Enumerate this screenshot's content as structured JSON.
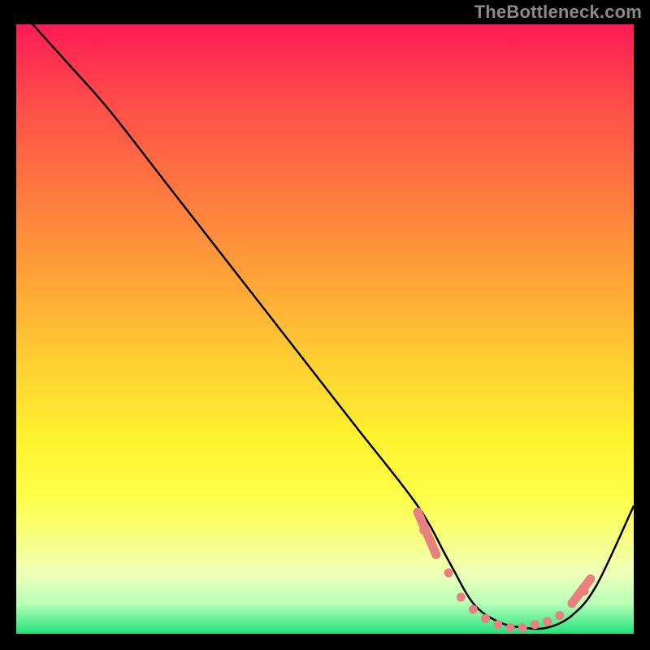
{
  "watermark": "TheBottleneck.com",
  "colors": {
    "background": "#000000",
    "curve": "#000000",
    "marker": "#e98080",
    "gradient_top": "#ff1a55",
    "gradient_bottom": "#21e27a"
  },
  "chart_data": {
    "type": "line",
    "title": "",
    "xlabel": "",
    "ylabel": "",
    "xlim": [
      0,
      100
    ],
    "ylim": [
      0,
      100
    ],
    "series": [
      {
        "name": "bottleneck-curve",
        "x": [
          0,
          8,
          15,
          25,
          35,
          45,
          55,
          65,
          70,
          74,
          78,
          82,
          86,
          90,
          94,
          100
        ],
        "values": [
          103,
          94,
          86,
          73,
          60,
          47,
          34,
          21,
          12,
          5,
          2,
          1,
          1,
          3,
          8,
          21
        ]
      }
    ],
    "markers": {
      "name": "highlighted-points",
      "x": [
        66,
        68,
        70,
        72,
        74,
        76,
        78,
        80,
        82,
        84,
        86,
        88,
        90,
        92
      ],
      "values": [
        17,
        13,
        10,
        6,
        4,
        2.5,
        1.5,
        1,
        1,
        1.5,
        2,
        3,
        5,
        7
      ]
    }
  }
}
